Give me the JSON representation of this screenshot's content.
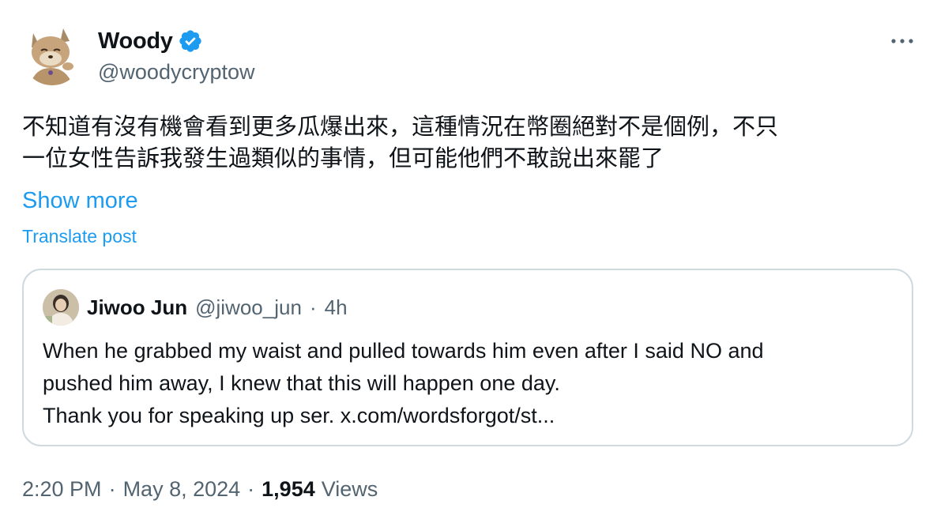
{
  "author": {
    "name": "Woody",
    "handle": "@woodycryptow",
    "verified": true
  },
  "post": {
    "lines": [
      "不知道有沒有機會看到更多瓜爆出來，這種情況在幣圈絕對不是個例，不只",
      "一位女性告訴我發生過類似的事情，但可能他們不敢說出來罷了"
    ],
    "show_more": "Show more",
    "translate": "Translate post"
  },
  "quoted": {
    "name": "Jiwoo Jun",
    "handle": "@jiwoo_jun",
    "dot": "·",
    "time": "4h",
    "lines": [
      "When he grabbed my waist and pulled towards him even after I said NO and",
      "pushed him away, I knew that this will happen one day.",
      "Thank you for speaking up ser. x.com/wordsforgot/st..."
    ]
  },
  "meta": {
    "time": "2:20 PM",
    "dot": "·",
    "date": "May 8, 2024",
    "views_count": "1,954",
    "views_label": "Views"
  },
  "colors": {
    "accent": "#1d9bf0",
    "secondary_text": "#536471",
    "border": "#cfd9de"
  },
  "icons": {
    "verified": "verified-badge-icon",
    "more": "more-horizontal-icon"
  }
}
